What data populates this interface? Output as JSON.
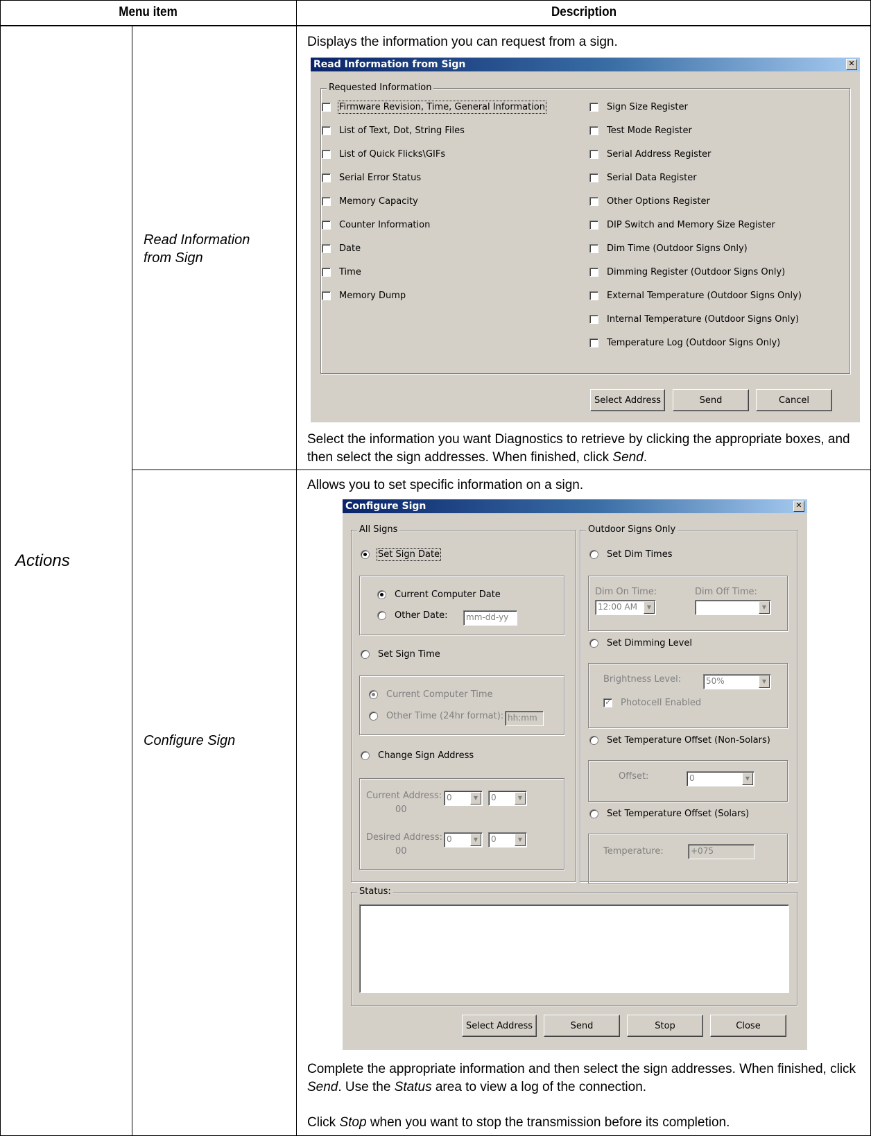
{
  "table": {
    "header_menu": "Menu item",
    "header_desc": "Description",
    "category": "Actions",
    "rows": [
      {
        "item": "Read Information from Sign",
        "intro": "Displays the information you can request from a sign.",
        "after_pre": "Select the information you want Diagnostics to retrieve by clicking the appropriate boxes, and then select the sign addresses. When finished, click ",
        "after_em": "Send",
        "after_post": "."
      },
      {
        "item": "Configure Sign",
        "intro": "Allows you to set specific information on a sign.",
        "after1_pre": "Complete the appropriate information and then select the sign addresses. When finished, click ",
        "after1_em1": "Send",
        "after1_mid": ". Use the ",
        "after1_em2": "Status",
        "after1_post": " area to view a log of the connection.",
        "after2_pre": "Click ",
        "after2_em": "Stop",
        "after2_post": " when you want to stop the transmission before its completion."
      }
    ]
  },
  "read_dialog": {
    "title": "Read Information from Sign",
    "group_label": "Requested Information",
    "left_items": [
      "Firmware Revision, Time, General Information",
      "List of Text, Dot, String Files",
      "List of Quick Flicks\\GIFs",
      "Serial Error Status",
      "Memory Capacity",
      "Counter Information",
      "Date",
      "Time",
      "Memory Dump"
    ],
    "right_items": [
      "Sign Size Register",
      "Test Mode Register",
      "Serial Address Register",
      "Serial Data Register",
      "Other Options Register",
      "DIP Switch and Memory Size Register",
      "Dim Time (Outdoor Signs Only)",
      "Dimming Register (Outdoor Signs Only)",
      "External Temperature (Outdoor Signs Only)",
      "Internal Temperature (Outdoor Signs Only)",
      "Temperature Log (Outdoor Signs Only)"
    ],
    "buttons": {
      "select_address": "Select Address",
      "send": "Send",
      "cancel": "Cancel"
    }
  },
  "config_dialog": {
    "title": "Configure Sign",
    "all_signs": {
      "label": "All Signs",
      "set_date": "Set Sign Date",
      "current_date": "Current Computer Date",
      "other_date": "Other Date:",
      "date_placeholder": "mm-dd-yy",
      "set_time": "Set Sign Time",
      "current_time": "Current Computer Time",
      "other_time": "Other Time (24hr format):",
      "time_placeholder": "hh:mm",
      "change_address": "Change Sign Address",
      "current_address": "Current Address:",
      "current_address_value": "00",
      "desired_address": "Desired Address:",
      "desired_address_value": "00",
      "digit": "0"
    },
    "outdoor": {
      "label": "Outdoor Signs Only",
      "set_dim_times": "Set Dim Times",
      "dim_on": "Dim On Time:",
      "dim_on_value": "12:00 AM",
      "dim_off": "Dim Off Time:",
      "set_dimming": "Set Dimming Level",
      "brightness": "Brightness Level:",
      "brightness_value": "50%",
      "photocell": "Photocell Enabled",
      "set_temp_nonsolar": "Set Temperature Offset (Non-Solars)",
      "offset": "Offset:",
      "offset_value": "0",
      "set_temp_solar": "Set Temperature Offset (Solars)",
      "temperature": "Temperature:",
      "temperature_value": "+075"
    },
    "status_label": "Status:",
    "buttons": {
      "select_address": "Select Address",
      "send": "Send",
      "stop": "Stop",
      "close": "Close"
    }
  }
}
